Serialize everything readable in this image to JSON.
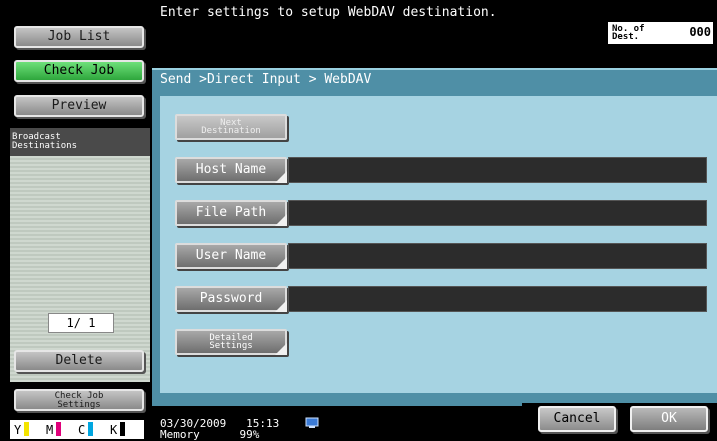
{
  "sidebar": {
    "job_list": "Job List",
    "check_job": "Check Job",
    "preview": "Preview",
    "broadcast_title": "Broadcast\nDestinations",
    "pager": "1/ 1",
    "delete": "Delete",
    "check_job_settings": "Check Job\nSettings",
    "toner": [
      {
        "label": "Y",
        "color": "#f4e400"
      },
      {
        "label": "M",
        "color": "#e0007a"
      },
      {
        "label": "C",
        "color": "#00a6e0"
      },
      {
        "label": "K",
        "color": "#000000"
      }
    ]
  },
  "header": {
    "message": "Enter settings to setup WebDAV destination.",
    "dest_label": "No. of\nDest.",
    "dest_count": "000"
  },
  "main": {
    "breadcrumb": "Send >Direct Input > WebDAV",
    "next_destination": "Next\nDestination",
    "fields": [
      {
        "label": "Host Name",
        "value": ""
      },
      {
        "label": "File Path",
        "value": ""
      },
      {
        "label": "User Name",
        "value": ""
      },
      {
        "label": "Password",
        "value": ""
      }
    ],
    "detailed_settings": "Detailed\nSettings"
  },
  "footer": {
    "date": "03/30/2009",
    "time": "15:13",
    "memory_label": "Memory",
    "memory_value": "99%",
    "cancel": "Cancel",
    "ok": "OK"
  }
}
